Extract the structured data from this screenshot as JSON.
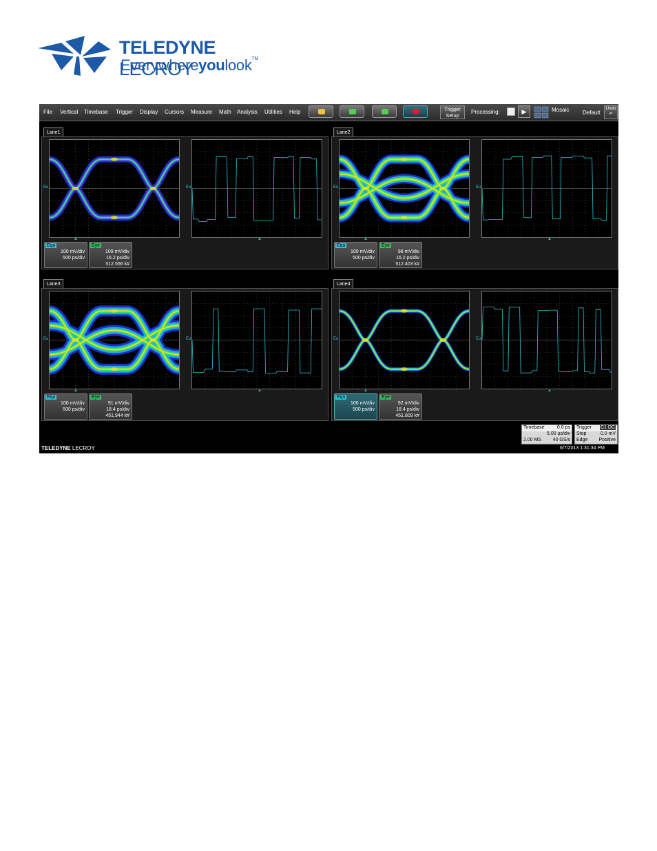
{
  "logo": {
    "brand_main": "TELEDYNE",
    "brand_secondary": "LECROY",
    "tagline_a": "Everywhere",
    "tagline_b": "you",
    "tagline_c": "look",
    "tm": "TM"
  },
  "menu": [
    "File",
    "Vertical",
    "Timebase",
    "Trigger",
    "Display",
    "Cursors",
    "Measure",
    "Math",
    "Analysis",
    "Utilities",
    "Help"
  ],
  "toolbar": {
    "trigger_setup_line1": "Trigger",
    "trigger_setup_line2": "Setup",
    "processing_label": "Processing:",
    "mosaic_label": "Mosaic",
    "default_label": "Default",
    "undo_label": "Undo",
    "stop_active_color": "#e02020",
    "run_color": "#50d050"
  },
  "lanes": [
    {
      "name": "Lane1",
      "equ_tag": "Equ",
      "equ_v": "100 mV/div",
      "equ_h": "500 ps/div",
      "eye_tag": "Eye",
      "eye_v": "109 mV/div",
      "eye_h": "16.2 ps/div",
      "eye_count": "512.556 k#",
      "marker": "Eu",
      "eye_style": "clean",
      "equ_selected": false
    },
    {
      "name": "Lane2",
      "equ_tag": "Equ",
      "equ_v": "100 mV/div",
      "equ_h": "500 ps/div",
      "eye_tag": "Eye",
      "eye_v": "98 mV/div",
      "eye_h": "16.2 ps/div",
      "eye_count": "512.403 k#",
      "marker": "Eu",
      "eye_style": "noisy",
      "equ_selected": false
    },
    {
      "name": "Lane3",
      "equ_tag": "Equ",
      "equ_v": "100 mV/div",
      "equ_h": "500 ps/div",
      "eye_tag": "Eye",
      "eye_v": "91 mV/div",
      "eye_h": "18.4 ps/div",
      "eye_count": "451.944 k#",
      "marker": "Eu",
      "eye_style": "closed",
      "equ_selected": false
    },
    {
      "name": "Lane4",
      "equ_tag": "Equ",
      "equ_v": "100 mV/div",
      "equ_h": "500 ps/div",
      "eye_tag": "Eye",
      "eye_v": "92 mV/div",
      "eye_h": "18.4 ps/div",
      "eye_count": "451.809 k#",
      "marker": "Eu",
      "eye_style": "thin",
      "equ_selected": true
    }
  ],
  "timebase": {
    "label": "Timebase",
    "delay": "0.0 ps",
    "per_div": "5.00 µs/div",
    "samples": "2.00 MS",
    "rate": "40 GS/s"
  },
  "trigger": {
    "label": "Trigger",
    "channel_icon": "C1 DC",
    "mode": "Stop",
    "level": "0.0 mV",
    "type": "Edge",
    "slope": "Positive"
  },
  "footer": {
    "brand_main": "TELEDYNE",
    "brand_secondary": "LECROY",
    "datetime": "6/7/2013 1:31:34 PM"
  },
  "colors": {
    "trace": "#2ec4d6",
    "brand_blue": "#1c5aa8",
    "scope_bg": "#000000"
  }
}
